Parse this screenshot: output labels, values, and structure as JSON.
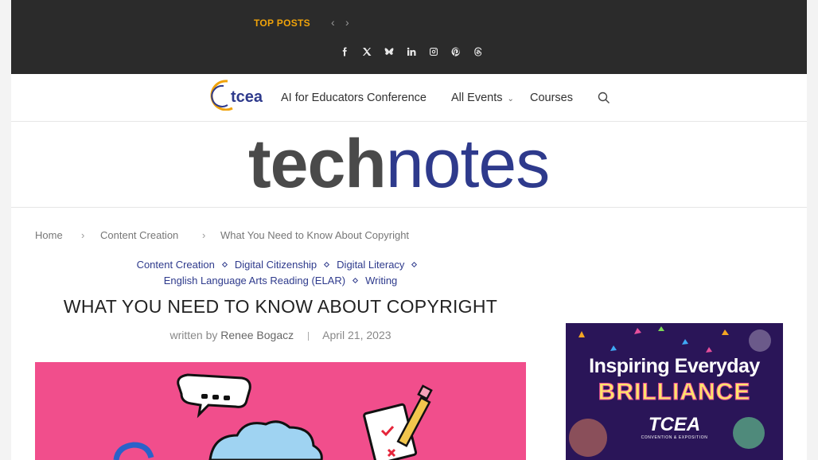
{
  "topbar": {
    "top_posts_label": "TOP POSTS",
    "prev_icon": "chevron-left-icon",
    "next_icon": "chevron-right-icon",
    "social": [
      "facebook-icon",
      "x-icon",
      "bluesky-icon",
      "linkedin-icon",
      "instagram-icon",
      "pinterest-icon",
      "threads-icon"
    ]
  },
  "nav": {
    "logo_text": "tcea",
    "items": [
      {
        "label": "AI for Educators Conference"
      },
      {
        "label": "All Events",
        "has_dropdown": true
      },
      {
        "label": "Courses"
      }
    ],
    "search_icon": "search-icon"
  },
  "masthead": {
    "brand_bold": "tech",
    "brand_light": "notes"
  },
  "breadcrumb": [
    "Home",
    "Content Creation",
    "What You Need to Know About Copyright"
  ],
  "article": {
    "categories": [
      "Content Creation",
      "Digital Citizenship",
      "Digital Literacy",
      "English Language Arts Reading (ELAR)",
      "Writing"
    ],
    "title": "WHAT YOU NEED TO KNOW ABOUT COPYRIGHT",
    "written_by": "written by",
    "author": "Renee Bogacz",
    "date": "April 21, 2023"
  },
  "ad": {
    "line1": "Inspiring Everyday",
    "line2": "BRILLIANCE",
    "brand": "TCEA",
    "sub": "CONVENTION & EXPOSITION"
  },
  "colors": {
    "accent": "#f0a30a",
    "brand_blue": "#2e3a8c",
    "topbar": "#2b2b2b",
    "hero_pink": "#f14e8c"
  }
}
